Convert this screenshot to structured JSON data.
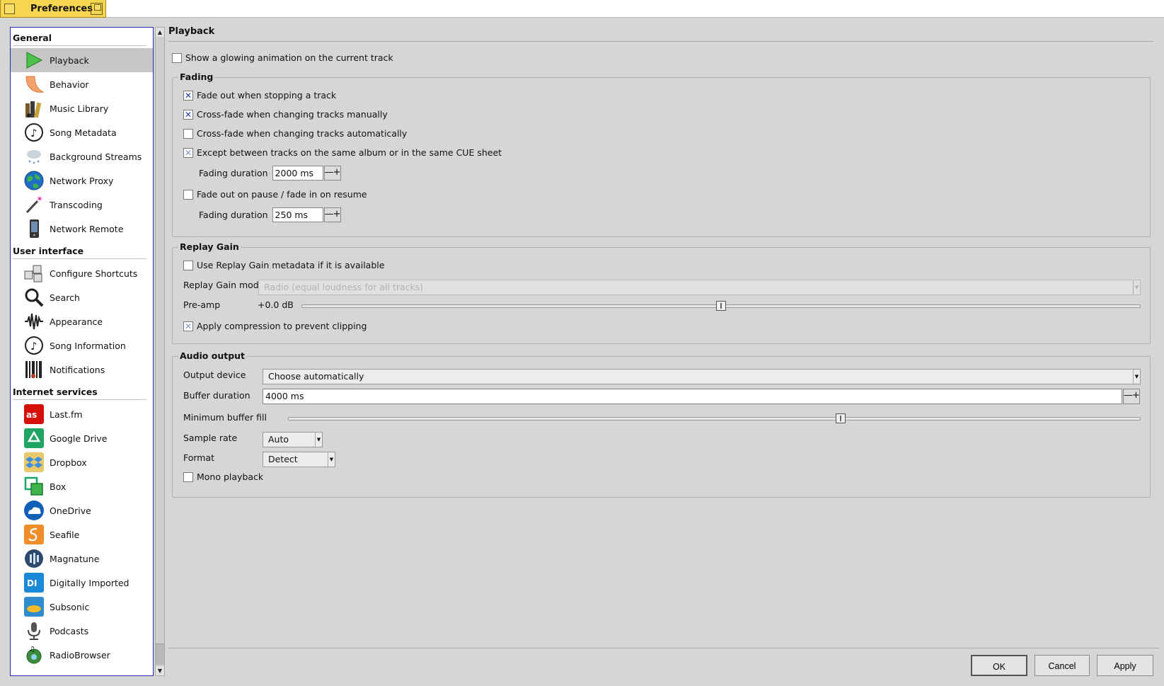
{
  "window": {
    "title": "Preferences"
  },
  "sidebar": {
    "sections": [
      {
        "title": "General",
        "items": [
          {
            "label": "Playback",
            "icon": "play-icon",
            "selected": true
          },
          {
            "label": "Behavior",
            "icon": "behavior-icon"
          },
          {
            "label": "Music Library",
            "icon": "music-library-icon"
          },
          {
            "label": "Song Metadata",
            "icon": "song-metadata-icon"
          },
          {
            "label": "Background Streams",
            "icon": "background-streams-icon"
          },
          {
            "label": "Network Proxy",
            "icon": "network-proxy-icon"
          },
          {
            "label": "Transcoding",
            "icon": "transcoding-icon"
          },
          {
            "label": "Network Remote",
            "icon": "network-remote-icon"
          }
        ]
      },
      {
        "title": "User interface",
        "items": [
          {
            "label": "Configure Shortcuts",
            "icon": "shortcuts-icon"
          },
          {
            "label": "Search",
            "icon": "search-icon"
          },
          {
            "label": "Appearance",
            "icon": "appearance-icon"
          },
          {
            "label": "Song Information",
            "icon": "song-information-icon"
          },
          {
            "label": "Notifications",
            "icon": "notifications-icon"
          }
        ]
      },
      {
        "title": "Internet services",
        "items": [
          {
            "label": "Last.fm",
            "icon": "lastfm-icon"
          },
          {
            "label": "Google Drive",
            "icon": "google-drive-icon"
          },
          {
            "label": "Dropbox",
            "icon": "dropbox-icon"
          },
          {
            "label": "Box",
            "icon": "box-icon"
          },
          {
            "label": "OneDrive",
            "icon": "onedrive-icon"
          },
          {
            "label": "Seafile",
            "icon": "seafile-icon"
          },
          {
            "label": "Magnatune",
            "icon": "magnatune-icon"
          },
          {
            "label": "Digitally Imported",
            "icon": "digitally-imported-icon"
          },
          {
            "label": "Subsonic",
            "icon": "subsonic-icon"
          },
          {
            "label": "Podcasts",
            "icon": "podcasts-icon"
          },
          {
            "label": "RadioBrowser",
            "icon": "radiobrowser-icon"
          }
        ]
      }
    ]
  },
  "playback": {
    "title": "Playback",
    "glow": {
      "label": "Show a glowing animation on the current track",
      "checked": false
    },
    "fading": {
      "title": "Fading",
      "fade_out_stop": {
        "label": "Fade out when stopping a track",
        "checked": true
      },
      "crossfade_manual": {
        "label": "Cross-fade when changing tracks manually",
        "checked": true
      },
      "crossfade_auto": {
        "label": "Cross-fade when changing tracks automatically",
        "checked": false
      },
      "except_album": {
        "label": "Except between tracks on the same album or in the same CUE sheet",
        "checked": true
      },
      "duration_label": "Fading duration",
      "duration_value": "2000 ms",
      "fade_pause": {
        "label": "Fade out on pause / fade in on resume",
        "checked": false
      },
      "pause_duration_label": "Fading duration",
      "pause_duration_value": "250 ms"
    },
    "replay_gain": {
      "title": "Replay Gain",
      "use_metadata": {
        "label": "Use Replay Gain metadata if it is available",
        "checked": false
      },
      "mode_label": "Replay Gain mode",
      "mode_value": "Radio (equal loudness for all tracks)",
      "preamp_label": "Pre-amp",
      "preamp_value": "+0.0 dB",
      "preamp_level": 0.5,
      "compression": {
        "label": "Apply compression to prevent clipping",
        "checked": true
      }
    },
    "audio_output": {
      "title": "Audio output",
      "device_label": "Output device",
      "device_value": "Choose automatically",
      "buffer_label": "Buffer duration",
      "buffer_value": "4000 ms",
      "min_fill_label": "Minimum buffer fill",
      "min_fill_level": 0.65,
      "sample_rate_label": "Sample rate",
      "sample_rate_value": "Auto",
      "format_label": "Format",
      "format_value": "Detect",
      "mono": {
        "label": "Mono playback",
        "checked": false
      }
    }
  },
  "buttons": {
    "ok": "OK",
    "cancel": "Cancel",
    "apply": "Apply"
  }
}
